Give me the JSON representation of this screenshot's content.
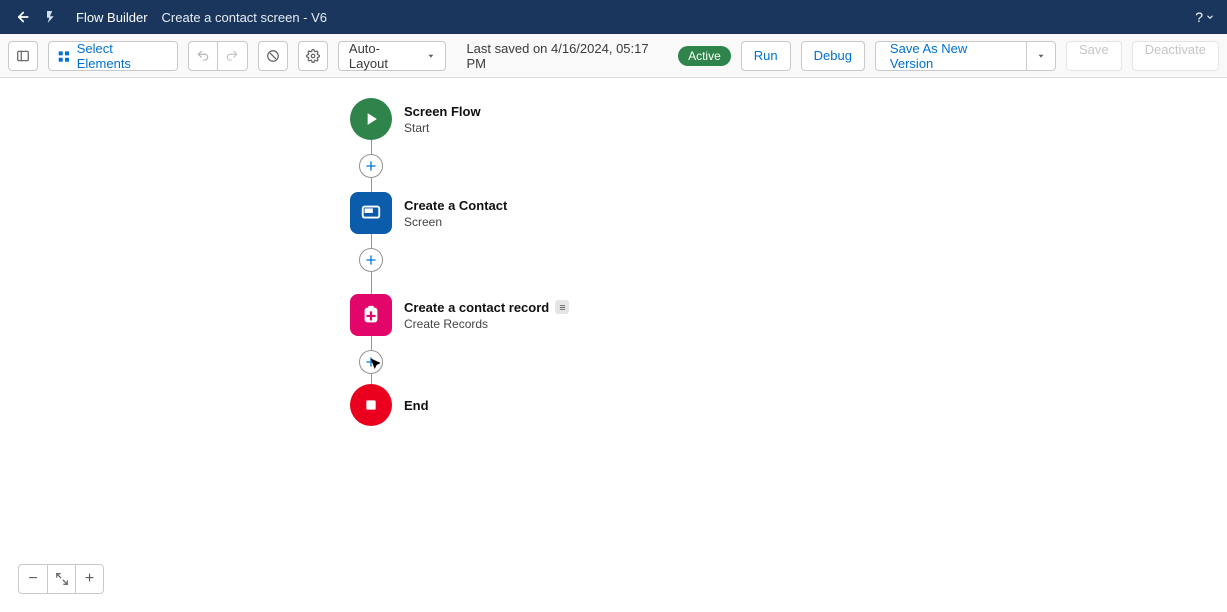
{
  "header": {
    "app_name": "Flow Builder",
    "flow_title": "Create a contact screen - V6",
    "help_label": "?"
  },
  "toolbar": {
    "select_elements": "Select Elements",
    "layout_mode": "Auto-Layout",
    "saved_text": "Last saved on 4/16/2024, 05:17 PM",
    "status_badge": "Active",
    "run": "Run",
    "debug": "Debug",
    "save_as": "Save As New Version",
    "save": "Save",
    "deactivate": "Deactivate"
  },
  "flow": {
    "nodes": [
      {
        "title": "Screen Flow",
        "subtitle": "Start"
      },
      {
        "title": "Create a Contact",
        "subtitle": "Screen"
      },
      {
        "title": "Create a contact record",
        "subtitle": "Create Records"
      },
      {
        "title": "End",
        "subtitle": ""
      }
    ]
  },
  "zoom": {
    "minus": "−",
    "fit": "⤢",
    "plus": "+"
  }
}
